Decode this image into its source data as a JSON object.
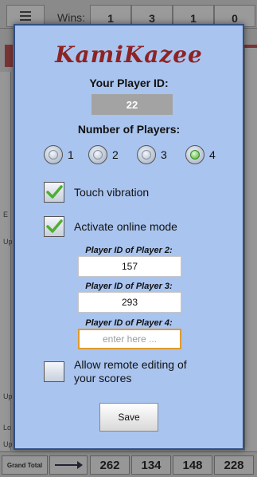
{
  "background": {
    "wins_label": "Wins:",
    "wins": [
      "1",
      "3",
      "1",
      "0"
    ],
    "left_row_labels": [
      "E",
      "Up",
      "",
      "",
      "",
      "Up",
      "Lo",
      "Up"
    ],
    "grand_total_label": "Grand Total",
    "grand_totals": [
      "262",
      "134",
      "148",
      "228"
    ]
  },
  "dialog": {
    "logo": "KamiKazee",
    "player_id_label": "Your Player ID:",
    "player_id_value": "22",
    "num_players_label": "Number of Players:",
    "num_players_options": [
      "1",
      "2",
      "3",
      "4"
    ],
    "num_players_selected": "4",
    "touch_vibration_label": "Touch vibration",
    "touch_vibration_checked": true,
    "online_mode_label": "Activate online mode",
    "online_mode_checked": true,
    "player2_label": "Player ID of Player 2:",
    "player2_value": "157",
    "player3_label": "Player ID of Player 3:",
    "player3_value": "293",
    "player4_label": "Player ID of Player 4:",
    "player4_placeholder": "enter here ...",
    "remote_edit_label_line1": "Allow remote editing of",
    "remote_edit_label_line2": "your scores",
    "remote_edit_checked": false,
    "save_label": "Save"
  },
  "colors": {
    "dialog_bg": "#a9c4ef",
    "dialog_border": "#2f4f86",
    "logo": "#8e2323",
    "focus_border": "#e09a2e"
  }
}
